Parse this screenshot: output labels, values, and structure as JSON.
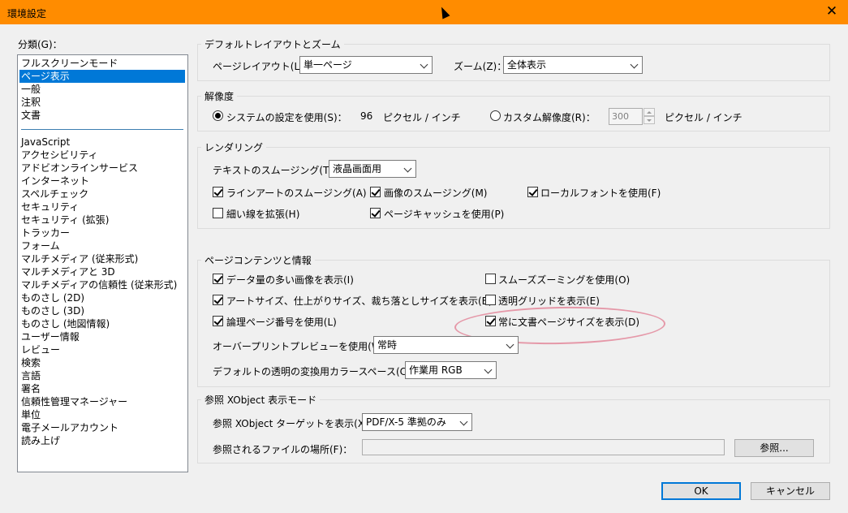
{
  "window": {
    "title": "環境設定"
  },
  "categories": {
    "label": "分類(G)：",
    "items": [
      "フルスクリーンモード",
      "ページ表示",
      "一般",
      "注釈",
      "文書",
      "JavaScript",
      "アクセシビリティ",
      "アドビオンラインサービス",
      "インターネット",
      "スペルチェック",
      "セキュリティ",
      "セキュリティ (拡張)",
      "トラッカー",
      "フォーム",
      "マルチメディア (従来形式)",
      "マルチメディアと 3D",
      "マルチメディアの信頼性 (従来形式)",
      "ものさし (2D)",
      "ものさし (3D)",
      "ものさし (地図情報)",
      "ユーザー情報",
      "レビュー",
      "検索",
      "言語",
      "署名",
      "信頼性管理マネージャー",
      "単位",
      "電子メールアカウント",
      "読み上げ"
    ],
    "selected": "ページ表示"
  },
  "layout": {
    "title": "デフォルトレイアウトとズーム",
    "page_layout_label": "ページレイアウト(L)：",
    "page_layout_value": "単一ページ",
    "zoom_label": "ズーム(Z)：",
    "zoom_value": "全体表示"
  },
  "resolution": {
    "title": "解像度",
    "system_label": "システムの設定を使用(S)：",
    "system_value": "96",
    "unit1": "ピクセル / インチ",
    "custom_label": "カスタム解像度(R)：",
    "custom_value": "300",
    "unit2": "ピクセル / インチ"
  },
  "rendering": {
    "title": "レンダリング",
    "smoothing_label": "テキストのスムージング(T)：",
    "smoothing_value": "液晶画面用",
    "lineart": "ラインアートのスムージング(A)",
    "image": "画像のスムージング(M)",
    "localfont": "ローカルフォントを使用(F)",
    "thinlines": "細い線を拡張(H)",
    "pagecache": "ページキャッシュを使用(P)"
  },
  "content": {
    "title": "ページコンテンツと情報",
    "largeimages": "データ量の多い画像を表示(I)",
    "smoothzoom": "スムーズズーミングを使用(O)",
    "artsize": "アートサイズ、仕上がりサイズ、裁ち落としサイズを表示(B)",
    "transgrid": "透明グリッドを表示(E)",
    "logical": "論理ページ番号を使用(L)",
    "docsize": "常に文書ページサイズを表示(D)",
    "overprint_label": "オーバープリントプレビューを使用(W)：",
    "overprint_value": "常時",
    "colorspace_label": "デフォルトの透明の変換用カラースペース(C)：",
    "colorspace_value": "作業用 RGB"
  },
  "xobject": {
    "title": "参照 XObject 表示モード",
    "target_label": "参照 XObject ターゲットを表示(X)：",
    "target_value": "PDF/X-5 準拠のみ",
    "location_label": "参照されるファイルの場所(F)：",
    "location_value": "",
    "browse": "参照..."
  },
  "buttons": {
    "ok": "OK",
    "cancel": "キャンセル"
  }
}
